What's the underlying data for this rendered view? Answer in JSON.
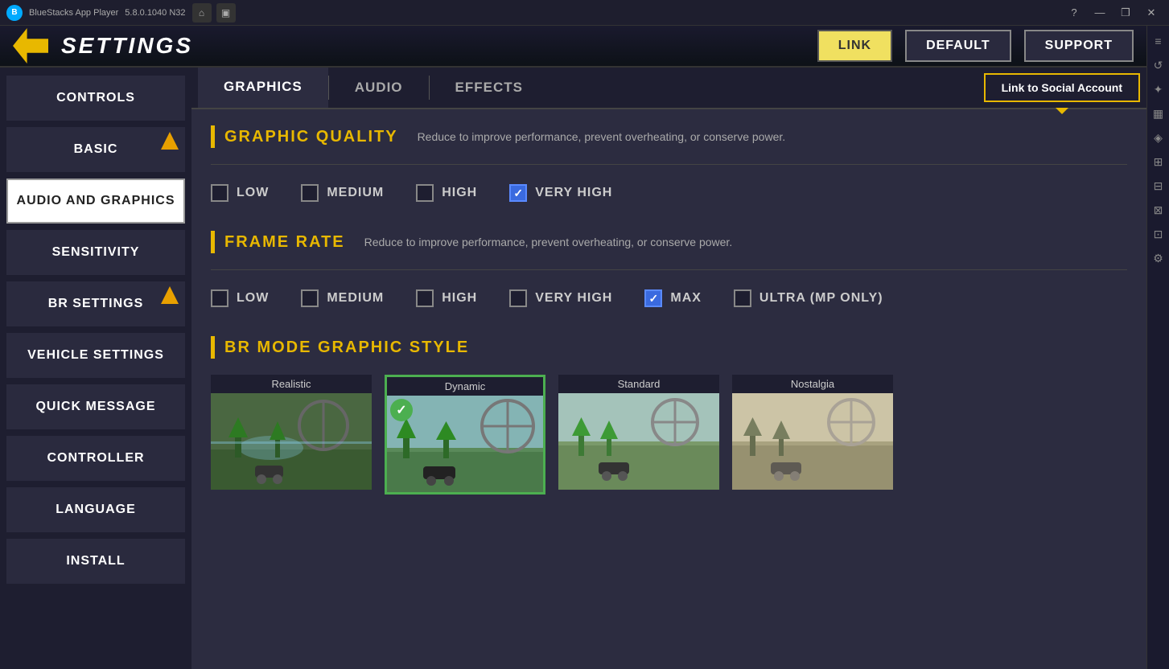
{
  "titlebar": {
    "app_name": "BlueStacks App Player",
    "version": "5.8.0.1040  N32",
    "nav": {
      "home_label": "⌂",
      "tabs_label": "▣"
    },
    "controls": {
      "help": "?",
      "minimize": "—",
      "restore": "❒",
      "close": "✕"
    }
  },
  "header": {
    "title": "SETTINGS",
    "buttons": {
      "link": "LINK",
      "default": "DEFAULT",
      "support": "SUPPORT"
    }
  },
  "sidebar": {
    "items": [
      {
        "id": "controls",
        "label": "CONTROLS",
        "active": false,
        "warn": false
      },
      {
        "id": "basic",
        "label": "BASIC",
        "active": false,
        "warn": true
      },
      {
        "id": "audio-and-graphics",
        "label": "AUDIO AND GRAPHICS",
        "active": true,
        "warn": false
      },
      {
        "id": "sensitivity",
        "label": "SENSITIVITY",
        "active": false,
        "warn": false
      },
      {
        "id": "br-settings",
        "label": "BR SETTINGS",
        "active": false,
        "warn": true
      },
      {
        "id": "vehicle-settings",
        "label": "VEHICLE SETTINGS",
        "active": false,
        "warn": false
      },
      {
        "id": "quick-message",
        "label": "QUICK MESSAGE",
        "active": false,
        "warn": false
      },
      {
        "id": "controller",
        "label": "CONTROLLER",
        "active": false,
        "warn": false
      },
      {
        "id": "language",
        "label": "LANGUAGE",
        "active": false,
        "warn": false
      },
      {
        "id": "install",
        "label": "INSTALL",
        "active": false,
        "warn": false
      }
    ]
  },
  "tabs": {
    "items": [
      {
        "id": "graphics",
        "label": "GRAPHICS",
        "active": true
      },
      {
        "id": "audio",
        "label": "AUDIO",
        "active": false
      },
      {
        "id": "effects",
        "label": "EFFECTS",
        "active": false
      }
    ],
    "social_link": "Link to Social Account"
  },
  "sections": {
    "graphic_quality": {
      "title": "GRAPHIC QUALITY",
      "description": "Reduce to improve performance, prevent overheating, or conserve power.",
      "options": [
        {
          "id": "low",
          "label": "LOW",
          "checked": false
        },
        {
          "id": "medium",
          "label": "MEDIUM",
          "checked": false
        },
        {
          "id": "high",
          "label": "HIGH",
          "checked": false
        },
        {
          "id": "very-high",
          "label": "VERY HIGH",
          "checked": true
        }
      ]
    },
    "frame_rate": {
      "title": "FRAME RATE",
      "description": "Reduce to improve performance, prevent overheating, or conserve power.",
      "options": [
        {
          "id": "low",
          "label": "LOW",
          "checked": false
        },
        {
          "id": "medium",
          "label": "MEDIUM",
          "checked": false
        },
        {
          "id": "high",
          "label": "HIGH",
          "checked": false
        },
        {
          "id": "very-high",
          "label": "VERY HIGH",
          "checked": false
        },
        {
          "id": "max",
          "label": "MAX",
          "checked": true
        },
        {
          "id": "ultra",
          "label": "ULTRA (MP Only)",
          "checked": false
        }
      ]
    },
    "br_mode": {
      "title": "BR MODE GRAPHIC STYLE",
      "styles": [
        {
          "id": "realistic",
          "label": "Realistic",
          "selected": false
        },
        {
          "id": "dynamic",
          "label": "Dynamic",
          "selected": true
        },
        {
          "id": "standard",
          "label": "Standard",
          "selected": false
        },
        {
          "id": "nostalgia",
          "label": "Nostalgia",
          "selected": false
        }
      ]
    }
  },
  "right_sidebar_icons": [
    "≡",
    "↺",
    "✦",
    "▦",
    "◈",
    "⊞",
    "⊟",
    "⊠",
    "⊡",
    "⚙"
  ]
}
